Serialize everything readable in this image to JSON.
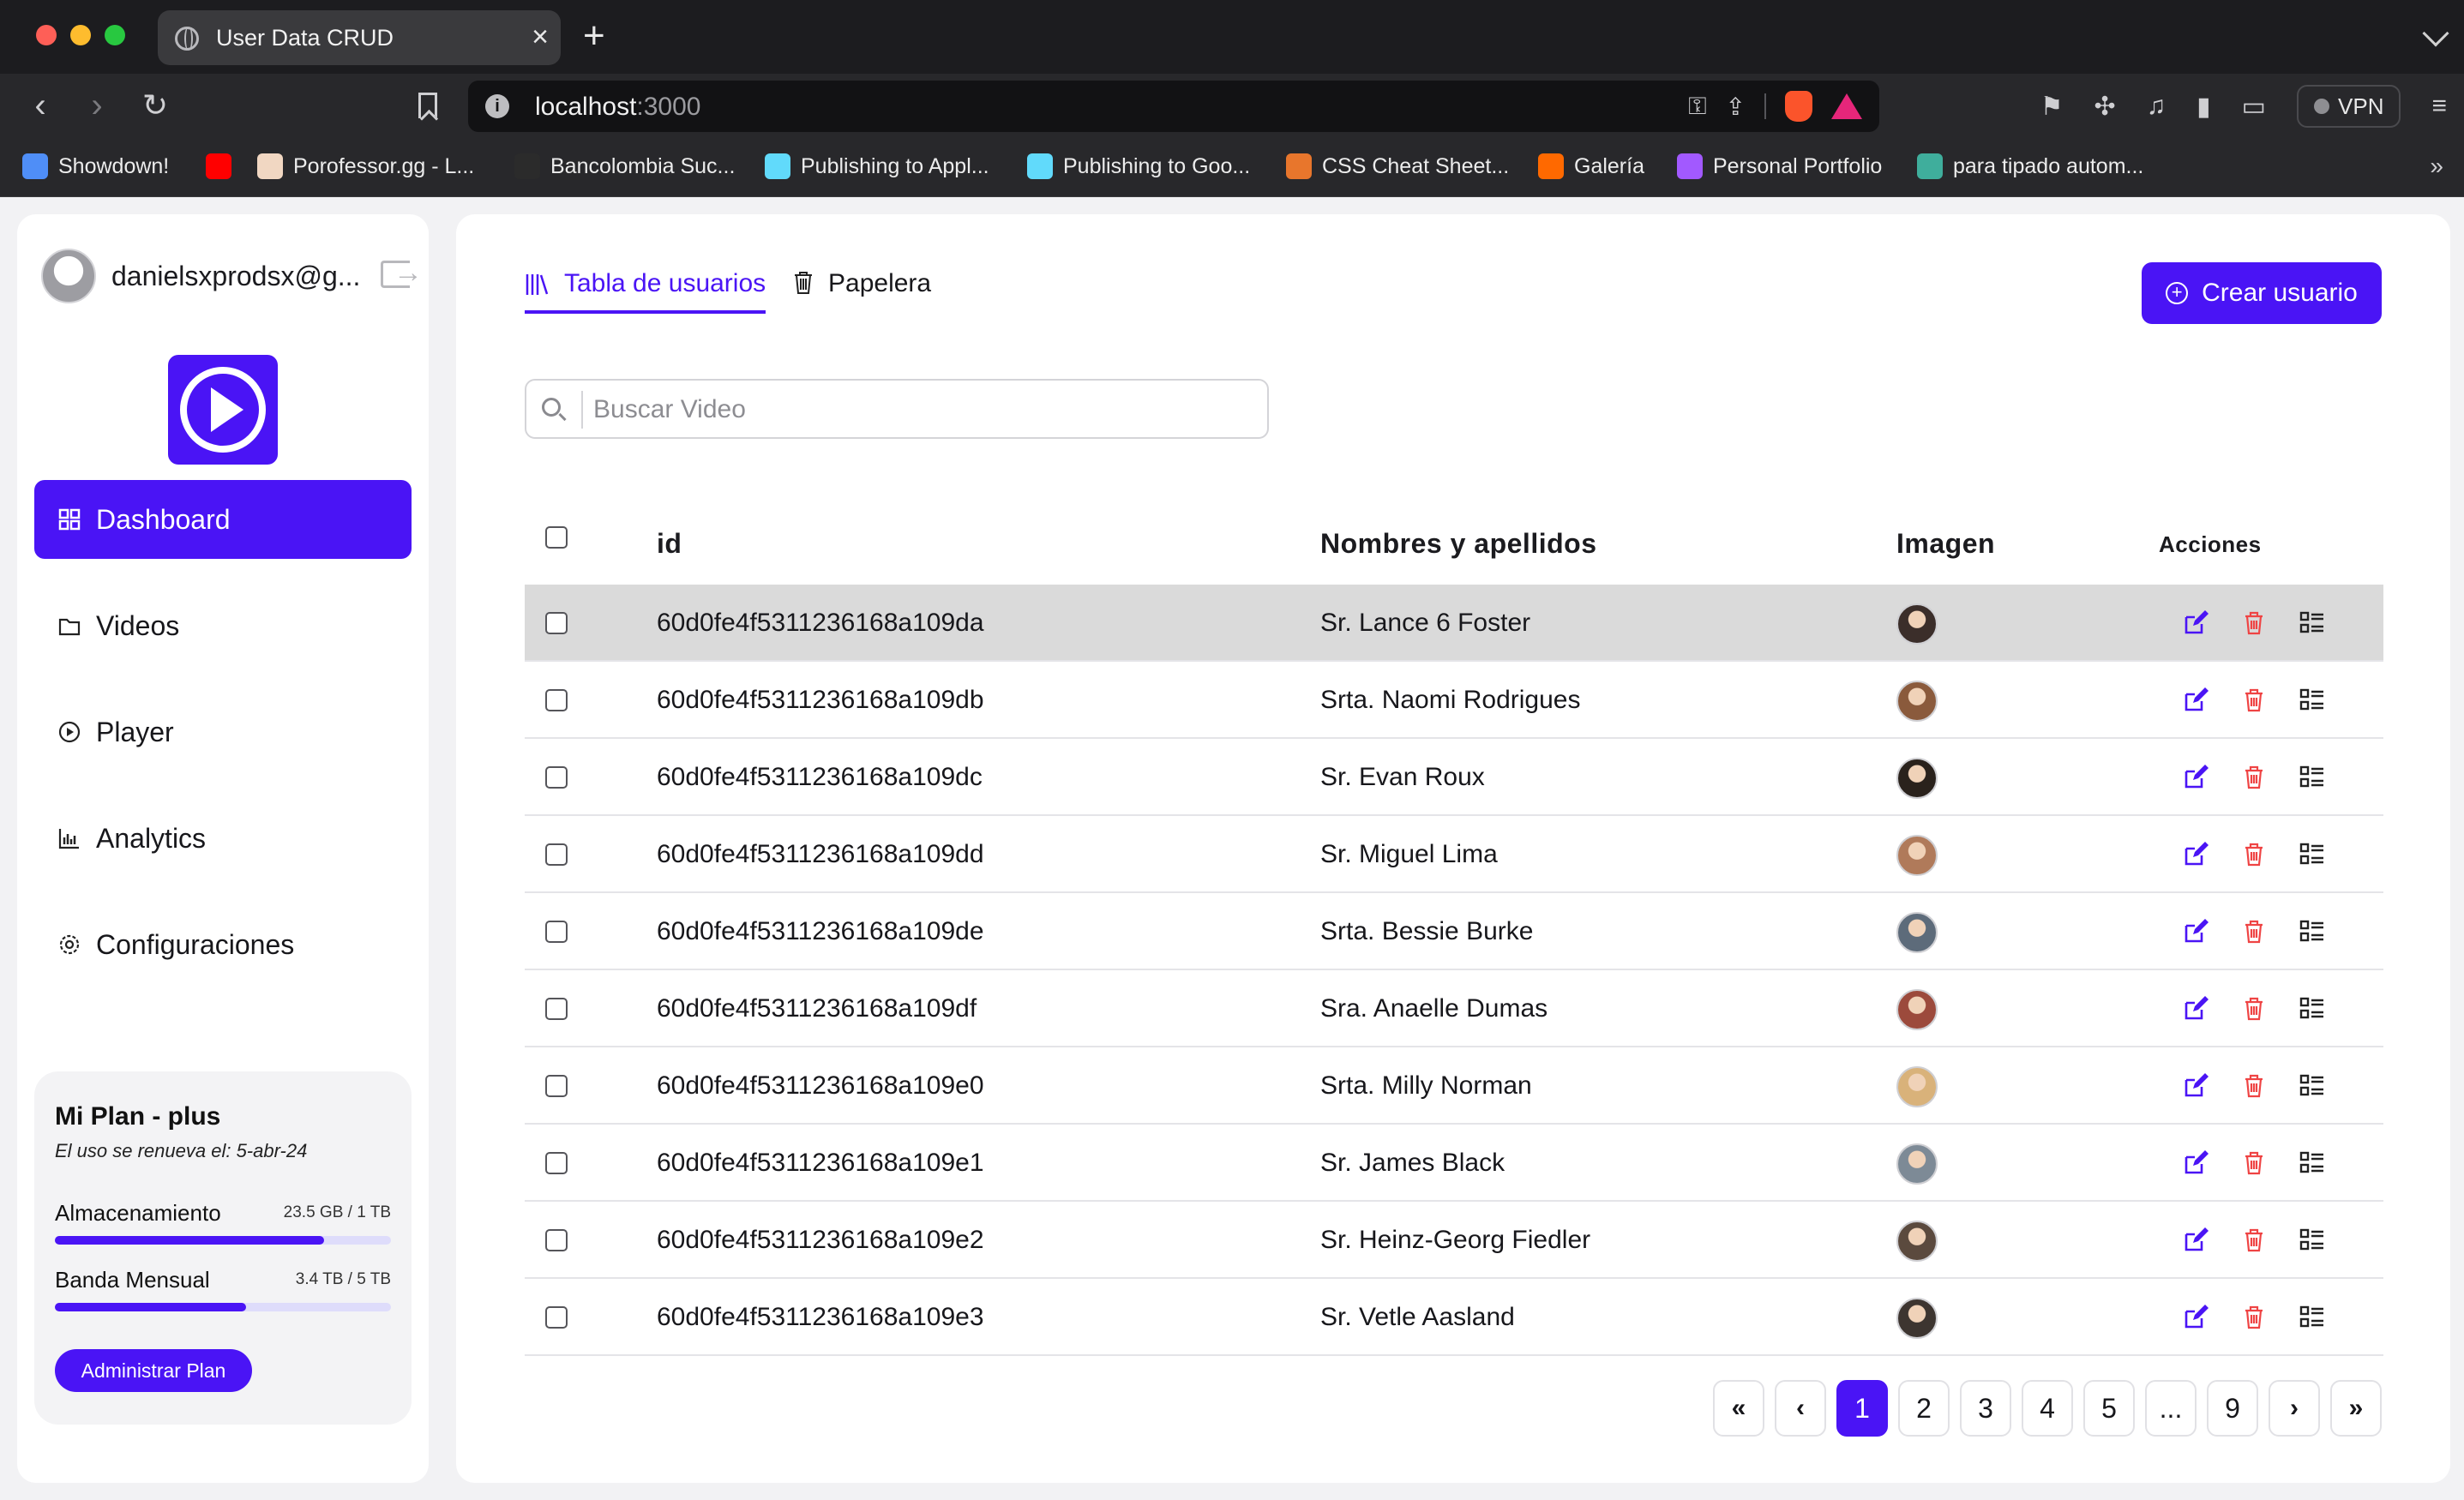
{
  "browser": {
    "tab_title": "User Data CRUD",
    "url_host": "localhost",
    "url_port": ":3000",
    "vpn_label": "VPN",
    "bookmarks": [
      {
        "label": "Showdown!",
        "color": "#4f8ef7"
      },
      {
        "label": "",
        "color": "#ff0000"
      },
      {
        "label": "Porofessor.gg - L...",
        "color": "#f1d7c2"
      },
      {
        "label": "Bancolombia Suc...",
        "color": "#2b2b2b"
      },
      {
        "label": "Publishing to Appl...",
        "color": "#61dafb"
      },
      {
        "label": "Publishing to Goo...",
        "color": "#61dafb"
      },
      {
        "label": "CSS Cheat Sheet...",
        "color": "#e8762c"
      },
      {
        "label": "Galería",
        "color": "#ff6900"
      },
      {
        "label": "Personal Portfolio",
        "color": "#a259ff"
      },
      {
        "label": "para tipado autom...",
        "color": "#3fae9c"
      }
    ]
  },
  "sidebar": {
    "user_email": "danielsxprodsx@g...",
    "menu": [
      {
        "label": "Dashboard",
        "icon": "dashboard-icon",
        "active": true
      },
      {
        "label": "Videos",
        "icon": "folder-icon",
        "active": false
      },
      {
        "label": "Player",
        "icon": "play-circle-icon",
        "active": false
      },
      {
        "label": "Analytics",
        "icon": "bar-chart-icon",
        "active": false
      },
      {
        "label": "Configuraciones",
        "icon": "gear-icon",
        "active": false
      }
    ],
    "plan": {
      "title": "Mi Plan - plus",
      "renew": "El uso se renueva el: 5-abr-24",
      "storage_label": "Almacenamiento",
      "storage_value": "23.5 GB / 1 TB",
      "storage_fraction": 0.8,
      "bandwidth_label": "Banda Mensual",
      "bandwidth_value": "3.4 TB / 5 TB",
      "bandwidth_fraction": 0.57,
      "button": "Administrar Plan"
    }
  },
  "main": {
    "tabs": {
      "users": "Tabla de usuarios",
      "trash": "Papelera"
    },
    "create_button": "Crear usuario",
    "search_placeholder": "Buscar Video",
    "columns": {
      "id": "id",
      "name": "Nombres y apellidos",
      "image": "Imagen",
      "actions": "Acciones"
    },
    "rows": [
      {
        "id": "60d0fe4f5311236168a109da",
        "name": "Sr. Lance 6 Foster",
        "avatar_color": "#3b2e2a",
        "highlight": true
      },
      {
        "id": "60d0fe4f5311236168a109db",
        "name": "Srta. Naomi Rodrigues",
        "avatar_color": "#8a5a3c",
        "highlight": false
      },
      {
        "id": "60d0fe4f5311236168a109dc",
        "name": "Sr. Evan Roux",
        "avatar_color": "#2a221c",
        "highlight": false
      },
      {
        "id": "60d0fe4f5311236168a109dd",
        "name": "Sr. Miguel Lima",
        "avatar_color": "#b07a5a",
        "highlight": false
      },
      {
        "id": "60d0fe4f5311236168a109de",
        "name": "Srta. Bessie Burke",
        "avatar_color": "#5d6b7a",
        "highlight": false
      },
      {
        "id": "60d0fe4f5311236168a109df",
        "name": "Sra. Anaelle Dumas",
        "avatar_color": "#9c4a3c",
        "highlight": false
      },
      {
        "id": "60d0fe4f5311236168a109e0",
        "name": "Srta. Milly Norman",
        "avatar_color": "#d9b27a",
        "highlight": false
      },
      {
        "id": "60d0fe4f5311236168a109e1",
        "name": "Sr. James Black",
        "avatar_color": "#7d8a96",
        "highlight": false
      },
      {
        "id": "60d0fe4f5311236168a109e2",
        "name": "Sr. Heinz-Georg Fiedler",
        "avatar_color": "#5b4a3e",
        "highlight": false
      },
      {
        "id": "60d0fe4f5311236168a109e3",
        "name": "Sr. Vetle Aasland",
        "avatar_color": "#3d3530",
        "highlight": false
      }
    ],
    "pagination": {
      "first": "«",
      "prev": "‹",
      "next": "›",
      "last": "»",
      "pages": [
        "1",
        "2",
        "3",
        "4",
        "5",
        "...",
        "9"
      ],
      "current": "1"
    }
  },
  "colors": {
    "accent": "#4a14f5",
    "delete": "#ef4444"
  }
}
